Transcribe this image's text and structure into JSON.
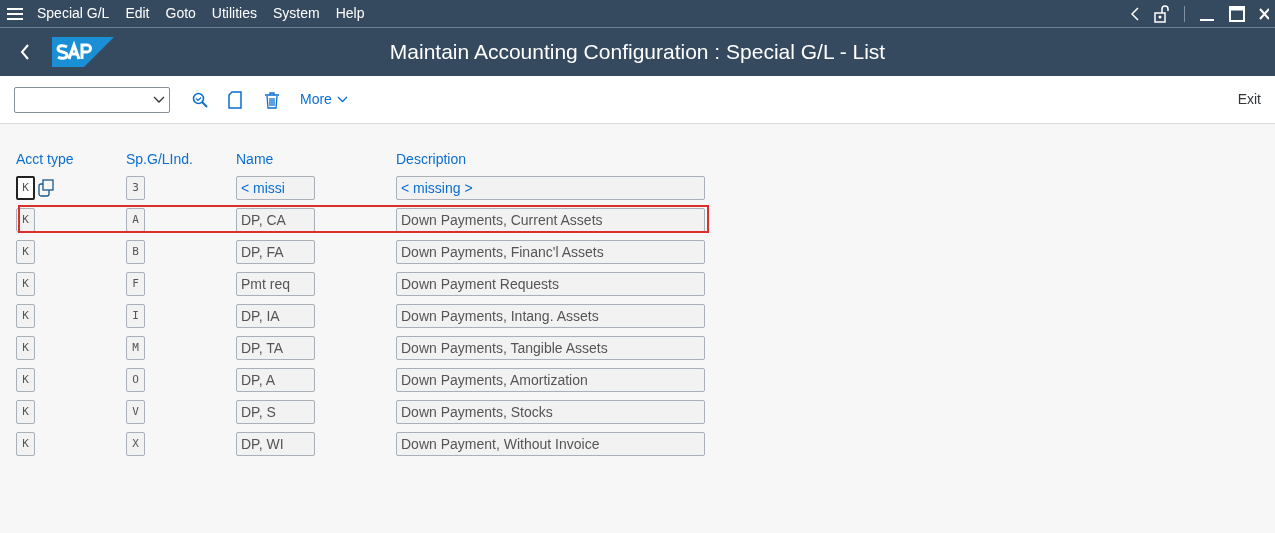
{
  "menu": [
    "Special G/L",
    "Edit",
    "Goto",
    "Utilities",
    "System",
    "Help"
  ],
  "title": "Maintain Accounting Configuration : Special G/L - List",
  "toolbar": {
    "more": "More",
    "exit": "Exit"
  },
  "columns": [
    "Acct type",
    "Sp.G/LInd.",
    "Name",
    "Description"
  ],
  "rows": [
    {
      "acct_type": "K",
      "indicator": "3",
      "name": "< missi",
      "description": "< missing >",
      "missing": true,
      "focused": true,
      "highlighted": false
    },
    {
      "acct_type": "K",
      "indicator": "A",
      "name": "DP, CA",
      "description": "Down Payments, Current Assets",
      "missing": false,
      "focused": false,
      "highlighted": true
    },
    {
      "acct_type": "K",
      "indicator": "B",
      "name": "DP, FA",
      "description": "Down Payments, Financ'l Assets",
      "missing": false,
      "focused": false,
      "highlighted": false
    },
    {
      "acct_type": "K",
      "indicator": "F",
      "name": "Pmt req",
      "description": "Down Payment Requests",
      "missing": false,
      "focused": false,
      "highlighted": false
    },
    {
      "acct_type": "K",
      "indicator": "I",
      "name": "DP, IA",
      "description": "Down Payments, Intang. Assets",
      "missing": false,
      "focused": false,
      "highlighted": false
    },
    {
      "acct_type": "K",
      "indicator": "M",
      "name": "DP, TA",
      "description": "Down Payments, Tangible Assets",
      "missing": false,
      "focused": false,
      "highlighted": false
    },
    {
      "acct_type": "K",
      "indicator": "O",
      "name": "DP, A",
      "description": "Down Payments, Amortization",
      "missing": false,
      "focused": false,
      "highlighted": false
    },
    {
      "acct_type": "K",
      "indicator": "V",
      "name": "DP, S",
      "description": "Down Payments, Stocks",
      "missing": false,
      "focused": false,
      "highlighted": false
    },
    {
      "acct_type": "K",
      "indicator": "X",
      "name": "DP, WI",
      "description": "Down Payment, Without Invoice",
      "missing": false,
      "focused": false,
      "highlighted": false
    }
  ]
}
